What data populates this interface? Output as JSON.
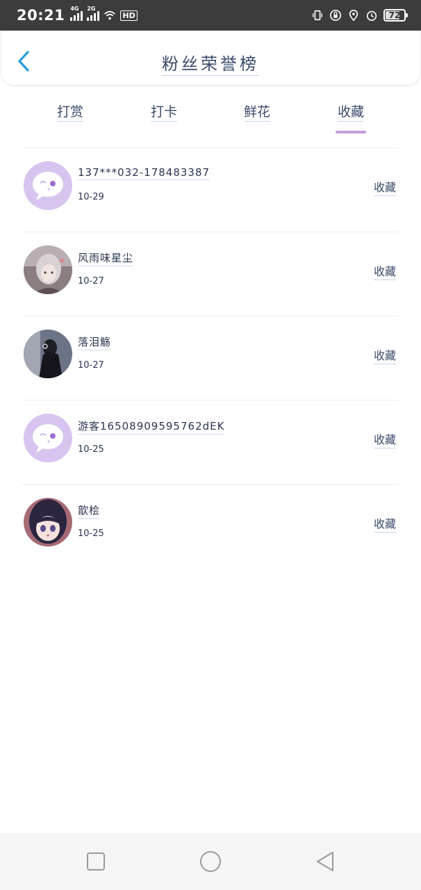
{
  "status_bar": {
    "time": "20:21",
    "net1": "4G",
    "net2": "2G",
    "hd": "HD",
    "battery": "72"
  },
  "header": {
    "title": "粉丝荣誉榜"
  },
  "tabs": [
    {
      "label": "打赏",
      "active": false
    },
    {
      "label": "打卡",
      "active": false
    },
    {
      "label": "鲜花",
      "active": false
    },
    {
      "label": "收藏",
      "active": true
    }
  ],
  "list": [
    {
      "name": "137***032-178483387",
      "date": "10-29",
      "action": "收藏",
      "avatar": "default-avatar-icon"
    },
    {
      "name": "风雨味星尘",
      "date": "10-27",
      "action": "收藏",
      "avatar": "user-photo"
    },
    {
      "name": "落泪觞",
      "date": "10-27",
      "action": "收藏",
      "avatar": "user-photo"
    },
    {
      "name": "游客16508909595762dEK",
      "date": "10-25",
      "action": "收藏",
      "avatar": "default-avatar-icon"
    },
    {
      "name": "歆桧",
      "date": "10-25",
      "action": "收藏",
      "avatar": "user-photo"
    }
  ],
  "colors": {
    "accent": "#c29fdc",
    "back_arrow": "#2a9ee0",
    "default_avatar_bg": "#d7c4ef"
  }
}
